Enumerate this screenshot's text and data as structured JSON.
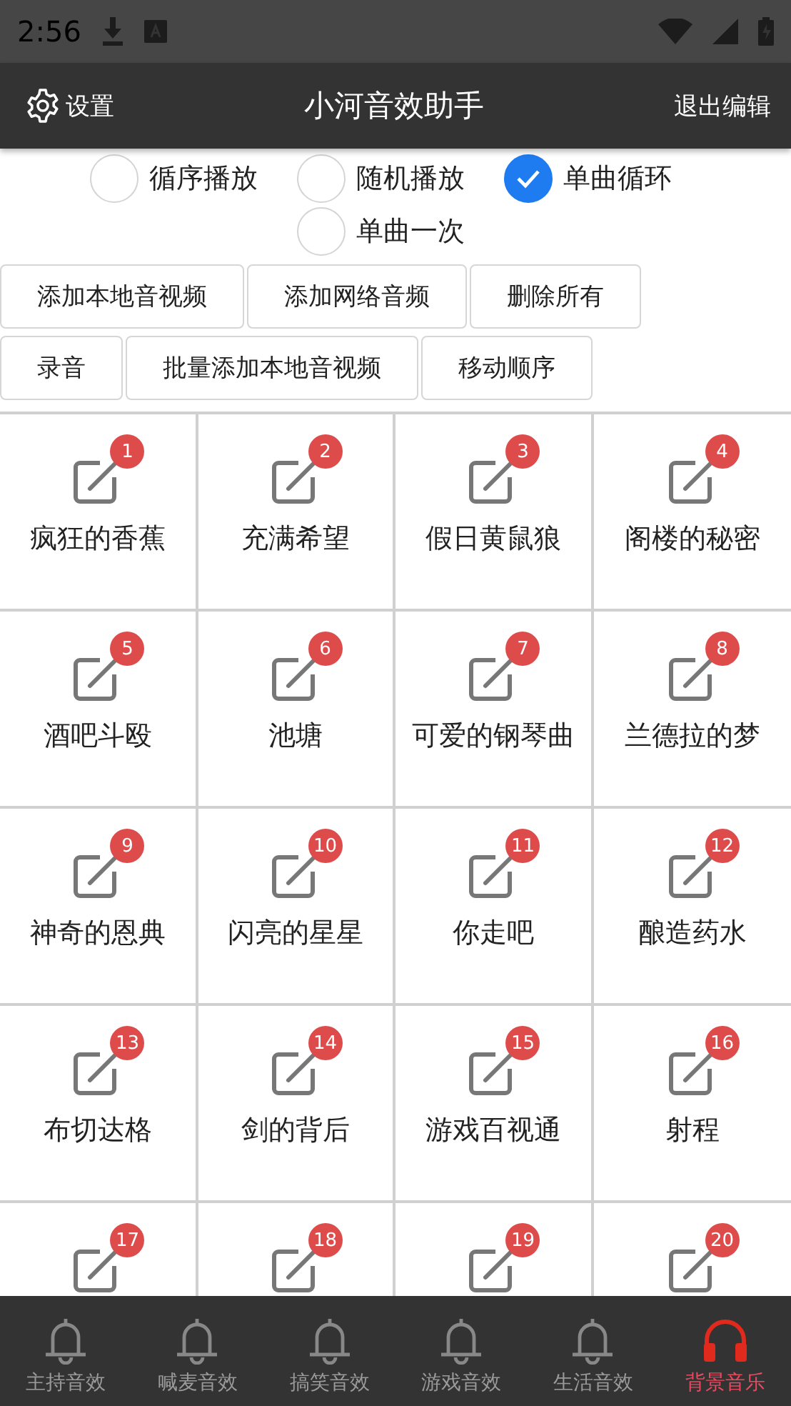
{
  "status_bar": {
    "time": "2:56"
  },
  "app_bar": {
    "settings": "设置",
    "title": "小河音效助手",
    "exit": "退出编辑"
  },
  "play_modes": [
    {
      "label": "循序播放",
      "selected": false
    },
    {
      "label": "随机播放",
      "selected": false
    },
    {
      "label": "单曲循环",
      "selected": true
    },
    {
      "label": "单曲一次",
      "selected": false
    }
  ],
  "button_rows": [
    [
      "添加本地音视频",
      "添加网络音频",
      "删除所有"
    ],
    [
      "录音",
      "批量添加本地音视频",
      "移动顺序"
    ]
  ],
  "sounds": [
    {
      "badge": "1",
      "label": "疯狂的香蕉"
    },
    {
      "badge": "2",
      "label": "充满希望"
    },
    {
      "badge": "3",
      "label": "假日黄鼠狼"
    },
    {
      "badge": "4",
      "label": "阁楼的秘密"
    },
    {
      "badge": "5",
      "label": "酒吧斗殴"
    },
    {
      "badge": "6",
      "label": "池塘"
    },
    {
      "badge": "7",
      "label": "可爱的钢琴曲"
    },
    {
      "badge": "8",
      "label": "兰德拉的梦"
    },
    {
      "badge": "9",
      "label": "神奇的恩典"
    },
    {
      "badge": "10",
      "label": "闪亮的星星"
    },
    {
      "badge": "11",
      "label": "你走吧"
    },
    {
      "badge": "12",
      "label": "酿造药水"
    },
    {
      "badge": "13",
      "label": "布切达格"
    },
    {
      "badge": "14",
      "label": "剑的背后"
    },
    {
      "badge": "15",
      "label": "游戏百视通"
    },
    {
      "badge": "16",
      "label": "射程"
    },
    {
      "badge": "17"
    },
    {
      "badge": "18"
    },
    {
      "badge": "19"
    },
    {
      "badge": "20"
    }
  ],
  "bottom_nav": [
    {
      "label": "主持音效",
      "kind": "bell",
      "selected": false
    },
    {
      "label": "喊麦音效",
      "kind": "bell",
      "selected": false
    },
    {
      "label": "搞笑音效",
      "kind": "bell",
      "selected": false
    },
    {
      "label": "游戏音效",
      "kind": "bell",
      "selected": false
    },
    {
      "label": "生活音效",
      "kind": "bell",
      "selected": false
    },
    {
      "label": "背景音乐",
      "kind": "headphones",
      "selected": true
    }
  ]
}
